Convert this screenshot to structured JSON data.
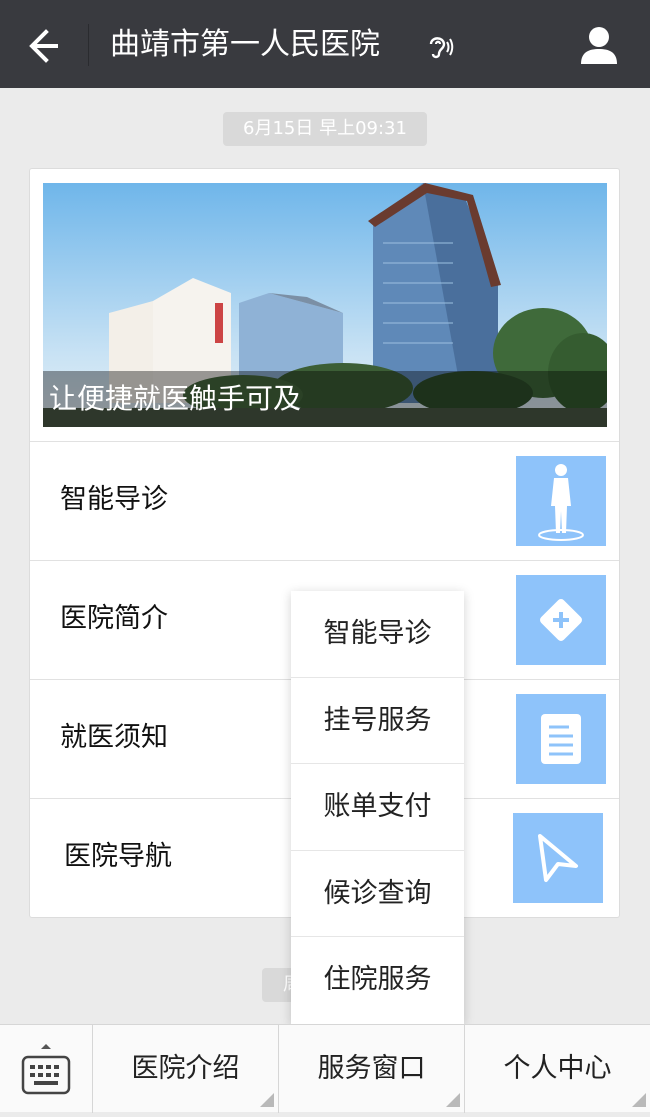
{
  "header": {
    "title": "曲靖市第一人民医院",
    "back_icon": "back-arrow-icon",
    "ear_icon": "ear-icon",
    "user_icon": "user-icon"
  },
  "timestamp": "6月15日 早上09:31",
  "timestamp2": "周",
  "card": {
    "banner_caption": "让便捷就医触手可及",
    "rows": [
      {
        "label": "智能导诊",
        "icon": "body-scan-icon"
      },
      {
        "label": "医院简介",
        "icon": "plus-diamond-icon"
      },
      {
        "label": "就医须知",
        "icon": "document-icon"
      },
      {
        "label": "医院导航",
        "icon": "navigation-arrow-icon"
      }
    ]
  },
  "popup_menu": {
    "items": [
      "智能导诊",
      "挂号服务",
      "账单支付",
      "候诊查询",
      "住院服务"
    ]
  },
  "bottom_bar": {
    "keyboard_icon": "keyboard-icon",
    "menus": [
      "医院介绍",
      "服务窗口",
      "个人中心"
    ]
  },
  "colors": {
    "header_bg": "#393a3f",
    "thumb_bg": "#8ec3fa",
    "page_bg": "#ebebeb"
  }
}
